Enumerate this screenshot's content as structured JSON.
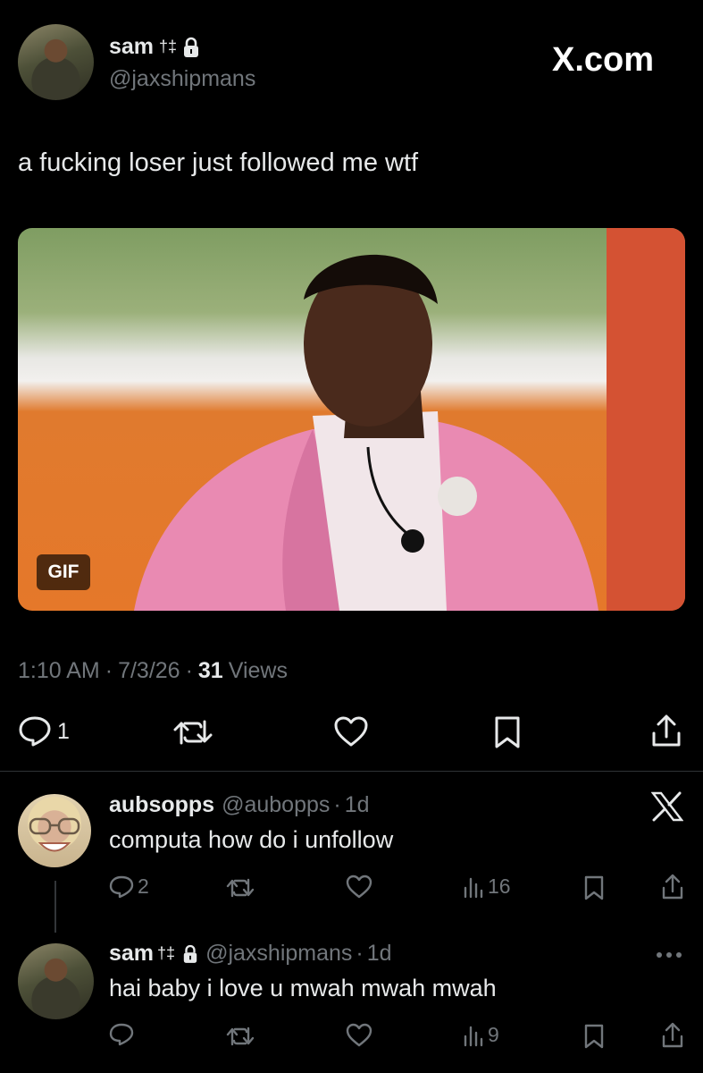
{
  "main_tweet": {
    "display_name": "sam",
    "name_glyph": "†‡",
    "handle": "@jaxshipmans",
    "text": "a fucking loser just followed me wtf",
    "media_badge": "GIF",
    "time": "1:10 AM",
    "date": "7/3/26",
    "views_count": "31",
    "views_label": "Views",
    "reply_count": "1"
  },
  "watermark": "X.com",
  "replies": [
    {
      "display_name": "aubsopps",
      "handle": "@aubopps",
      "age": "1d",
      "text": "computa how do i unfollow",
      "reply_count": "2",
      "views": "16"
    },
    {
      "display_name": "sam",
      "name_glyph": "†‡",
      "handle": "@jaxshipmans",
      "age": "1d",
      "text": "hai baby i love u mwah mwah mwah",
      "views": "9"
    }
  ],
  "colors": {
    "background": "#000000",
    "text": "#e7e9ea",
    "muted": "#71767b",
    "divider": "#2f3336"
  }
}
